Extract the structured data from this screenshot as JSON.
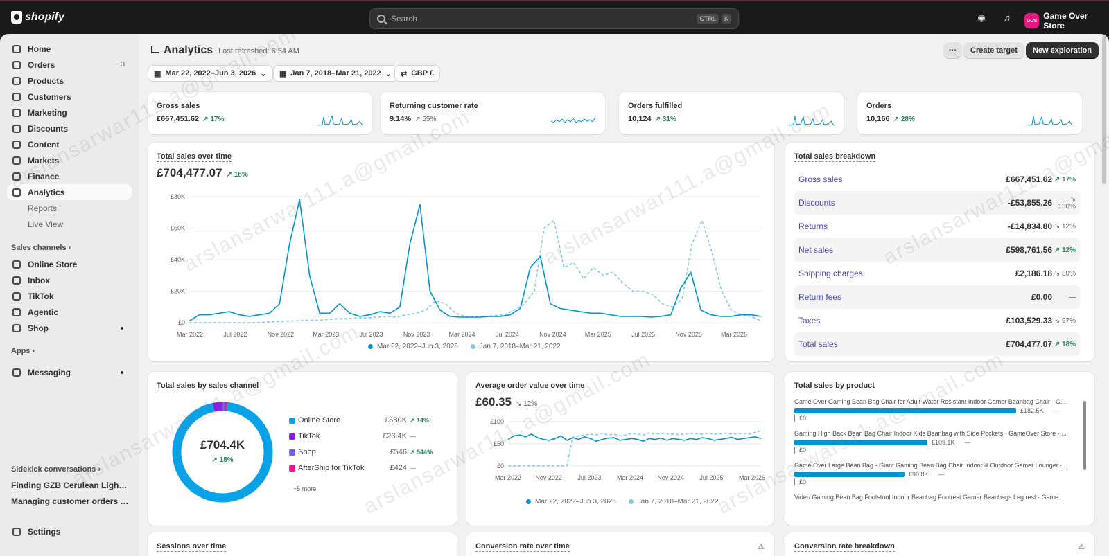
{
  "topbar": {
    "logo_text": "shopify",
    "search_placeholder": "Search",
    "kbd1": "CTRL",
    "kbd2": "K",
    "store_initials": "GOS",
    "store_name": "Game Over Store"
  },
  "sidebar": {
    "items": [
      {
        "label": "Home",
        "icon": "home-icon"
      },
      {
        "label": "Orders",
        "icon": "orders-icon",
        "badge": "3"
      },
      {
        "label": "Products",
        "icon": "tag-icon"
      },
      {
        "label": "Customers",
        "icon": "person-icon"
      },
      {
        "label": "Marketing",
        "icon": "target-icon"
      },
      {
        "label": "Discounts",
        "icon": "discount-icon"
      },
      {
        "label": "Content",
        "icon": "content-icon"
      },
      {
        "label": "Markets",
        "icon": "globe-icon"
      },
      {
        "label": "Finance",
        "icon": "bank-icon"
      },
      {
        "label": "Analytics",
        "icon": "chart-icon"
      }
    ],
    "subitems": [
      "Reports",
      "Live View"
    ],
    "sales_channels_label": "Sales channels",
    "channels": [
      {
        "label": "Online Store",
        "icon": "store-icon"
      },
      {
        "label": "Inbox",
        "icon": "inbox-icon"
      },
      {
        "label": "TikTok",
        "icon": "tiktok-icon"
      },
      {
        "label": "Agentic",
        "icon": "agentic-icon"
      },
      {
        "label": "Shop",
        "icon": "shop-icon"
      }
    ],
    "apps_label": "Apps",
    "messaging_label": "Messaging",
    "sidekick_label": "Sidekick conversations",
    "sidekick_items": [
      "Finding GZB Cerulean Lightnin...",
      "Managing customer orders in ..."
    ],
    "settings_label": "Settings"
  },
  "header": {
    "title": "Analytics",
    "refreshed": "Last refreshed: 6:54 AM",
    "more_label": "···",
    "create_target": "Create target",
    "new_exploration": "New exploration",
    "filters": [
      "Mar 22, 2022–Jun 3, 2026",
      "Jan 7, 2018–Mar 21, 2022",
      "GBP £"
    ]
  },
  "kpis": [
    {
      "title": "Gross sales",
      "value": "£667,451.62",
      "change": "17%",
      "dir": "up"
    },
    {
      "title": "Returning customer rate",
      "value": "9.14%",
      "change": "55%",
      "dir": "down"
    },
    {
      "title": "Orders fulfilled",
      "value": "10,124",
      "change": "31%",
      "dir": "up"
    },
    {
      "title": "Orders",
      "value": "10,166",
      "change": "28%",
      "dir": "up"
    }
  ],
  "total_sales": {
    "title": "Total sales over time",
    "value": "£704,477.07",
    "change": "18%",
    "legend": [
      "Mar 22, 2022–Jun 3, 2026",
      "Jan 7, 2018–Mar 21, 2022"
    ]
  },
  "breakdown": {
    "title": "Total sales breakdown",
    "rows": [
      {
        "label": "Gross sales",
        "value": "£667,451.62",
        "change": "17%",
        "dir": "up"
      },
      {
        "label": "Discounts",
        "value": "-£53,855.26",
        "change": "130%",
        "dir": "down"
      },
      {
        "label": "Returns",
        "value": "-£14,834.80",
        "change": "12%",
        "dir": "down"
      },
      {
        "label": "Net sales",
        "value": "£598,761.56",
        "change": "12%",
        "dir": "up"
      },
      {
        "label": "Shipping charges",
        "value": "£2,186.18",
        "change": "80%",
        "dir": "down"
      },
      {
        "label": "Return fees",
        "value": "£0.00",
        "change": "—",
        "dir": "none"
      },
      {
        "label": "Taxes",
        "value": "£103,529.33",
        "change": "97%",
        "dir": "down"
      },
      {
        "label": "Total sales",
        "value": "£704,477.07",
        "change": "18%",
        "dir": "up"
      }
    ]
  },
  "channel": {
    "title": "Total sales by sales channel",
    "center_value": "£704.4K",
    "center_change": "18%",
    "more": "+5 more",
    "rows": [
      {
        "label": "Online Store",
        "value": "£680K",
        "change": "14%",
        "color": "#0aa2e6"
      },
      {
        "label": "TikTok",
        "value": "£23.4K",
        "change": "—",
        "color": "#8b1ee0"
      },
      {
        "label": "Shop",
        "value": "£546",
        "change": "544%",
        "color": "#7a5af8"
      },
      {
        "label": "AfterShip for TikTok",
        "value": "£424",
        "change": "—",
        "color": "#e3178f"
      }
    ]
  },
  "aov": {
    "title": "Average order value over time",
    "value": "£60.35",
    "change": "12%",
    "legend": [
      "Mar 22, 2022–Jun 3, 2026",
      "Jan 7, 2018–Mar 21, 2022"
    ]
  },
  "products": {
    "title": "Total sales by product",
    "items": [
      {
        "name": "Game Over Gaming Bean Bag Chair for Adult Water Resistant Indoor Gamer Beanbag Chair · G...",
        "value": "£182.5K",
        "share": 1.0,
        "prev": "£0"
      },
      {
        "name": "Gaming High Back Bean Bag Chair Indoor Kids Beanbag with Side Pockets · GameOver Store · ...",
        "value": "£109.1K",
        "share": 0.6,
        "prev": "£0"
      },
      {
        "name": "Game Over Large Bean Bag - Giant Gaming Bean Bag Chair Indoor & Outdoor Gamer Lounger · ...",
        "value": "£90.8K",
        "share": 0.497,
        "prev": "£0"
      },
      {
        "name": "Video Gaming Bean Bag Footstool Indoor Beanbag Footrest Gamer Beanbags Leg rest · Game...",
        "value": "",
        "share": 0,
        "prev": ""
      }
    ]
  },
  "bottom_cards": [
    "Sessions over time",
    "Conversion rate over time",
    "Conversion rate breakdown"
  ],
  "watermark": "arslansarwar111.a@gmail.com",
  "chart_data": [
    {
      "type": "line",
      "title": "Total sales over time",
      "x_ticks": [
        "Mar 2022",
        "Jul 2022",
        "Nov 2022",
        "Mar 2023",
        "Jul 2023",
        "Nov 2023",
        "Mar 2024",
        "Jul 2024",
        "Nov 2024",
        "Mar 2025",
        "Jul 2025",
        "Nov 2025",
        "Mar 2026"
      ],
      "y_ticks": [
        "£0",
        "£20K",
        "£40K",
        "£60K",
        "£80K"
      ],
      "ylim": [
        0,
        80000
      ],
      "series": [
        {
          "name": "Mar 22, 2022–Jun 3, 2026",
          "style": "solid",
          "color": "#0094d5",
          "values": [
            1000,
            5000,
            5000,
            6000,
            7000,
            5000,
            4000,
            5000,
            6000,
            12000,
            50000,
            78000,
            30000,
            6000,
            6000,
            12000,
            6000,
            4000,
            5000,
            7000,
            6000,
            10000,
            50000,
            75000,
            20000,
            8000,
            4000,
            3500,
            3500,
            3500,
            4000,
            4000,
            5000,
            9000,
            35000,
            42000,
            12000,
            9000,
            8000,
            7000,
            6000,
            6000,
            5000,
            4000,
            4000,
            4000,
            3500,
            4000,
            5000,
            22000,
            32000,
            8000,
            5000,
            4000,
            4000,
            5000,
            5000,
            4000
          ]
        },
        {
          "name": "Jan 7, 2018–Mar 21, 2022",
          "style": "dashed",
          "color": "#7fc8ea",
          "values": [
            0,
            0,
            0,
            0,
            0,
            0,
            0,
            0,
            500,
            800,
            1000,
            1200,
            1500,
            1500,
            2000,
            2500,
            2500,
            3000,
            3000,
            3500,
            4000,
            3500,
            5000,
            6000,
            8000,
            14000,
            12000,
            6000,
            4000,
            4000,
            4000,
            4500,
            5000,
            8000,
            12000,
            20000,
            60000,
            65000,
            35000,
            38000,
            28000,
            35000,
            30000,
            32000,
            25000,
            20000,
            20000,
            18000,
            12000,
            10000,
            15000,
            50000,
            65000,
            45000,
            20000,
            8000,
            5000,
            4000,
            1000
          ]
        }
      ]
    },
    {
      "type": "pie",
      "title": "Total sales by sales channel",
      "categories": [
        "Online Store",
        "TikTok",
        "Shop",
        "AfterShip for TikTok"
      ],
      "values": [
        680000,
        23400,
        546,
        424
      ]
    },
    {
      "type": "line",
      "title": "Average order value over time",
      "x_ticks": [
        "Mar 2022",
        "Nov 2022",
        "Jul 2023",
        "Mar 2024",
        "Nov 2024",
        "Jul 2025",
        "Mar 2026"
      ],
      "y_ticks": [
        "£0",
        "£50",
        "£100"
      ],
      "ylim": [
        0,
        100
      ],
      "series": [
        {
          "name": "Mar 22, 2022–Jun 3, 2026",
          "style": "solid",
          "color": "#0094d5",
          "values": [
            60,
            68,
            70,
            66,
            72,
            64,
            60,
            58,
            62,
            68,
            58,
            64,
            60,
            66,
            62,
            56,
            60,
            63,
            64,
            58,
            60,
            62,
            60,
            56,
            62,
            60,
            63,
            58,
            62,
            60,
            58,
            62,
            60,
            64,
            62,
            58,
            60,
            62,
            65,
            60,
            62,
            64,
            66,
            62
          ]
        },
        {
          "name": "Jan 7, 2018–Mar 21, 2022",
          "style": "dashed",
          "color": "#7fc8ea",
          "values": [
            0,
            0,
            0,
            0,
            0,
            0,
            0,
            0,
            0,
            0,
            0,
            66,
            68,
            70,
            72,
            70,
            74,
            70,
            72,
            68,
            70,
            74,
            72,
            70,
            75,
            72,
            74,
            73,
            72,
            71,
            72,
            74,
            73,
            72,
            74,
            72,
            73,
            74,
            72,
            73,
            74,
            72,
            76,
            80
          ]
        }
      ]
    }
  ]
}
